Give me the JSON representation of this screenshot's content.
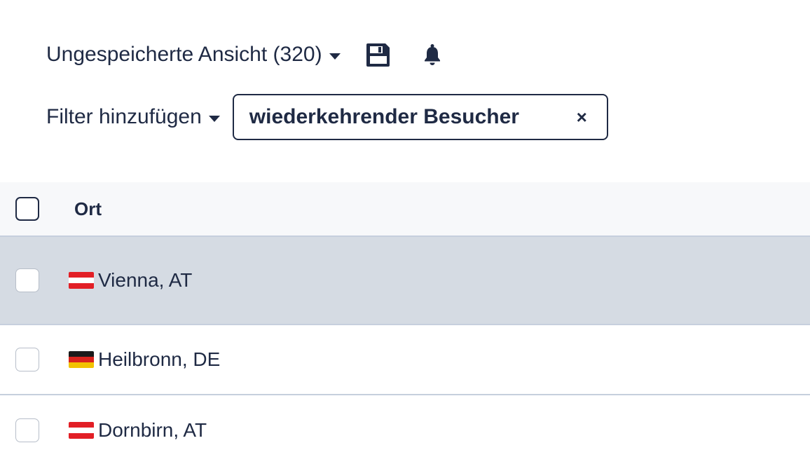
{
  "view": {
    "label": "Ungespeicherte Ansicht (320)",
    "save_icon": "save-icon",
    "bell_icon": "bell-icon"
  },
  "filter": {
    "add_label": "Filter hinzufügen",
    "chips": [
      {
        "label": "wiederkehrender Besucher",
        "close": "×"
      }
    ]
  },
  "table": {
    "header": {
      "column_label": "Ort"
    },
    "rows": [
      {
        "city": "Vienna, AT",
        "flag": "flag-austria-icon"
      },
      {
        "city": "Heilbronn, DE",
        "flag": "flag-germany-icon"
      },
      {
        "city": "Dornbirn, AT",
        "flag": "flag-austria-icon"
      }
    ]
  },
  "colors": {
    "text": "#1f2a44",
    "selected_row": "#d5dbe3",
    "header_bg": "#f7f8fa",
    "divider": "#c6cfdd"
  }
}
